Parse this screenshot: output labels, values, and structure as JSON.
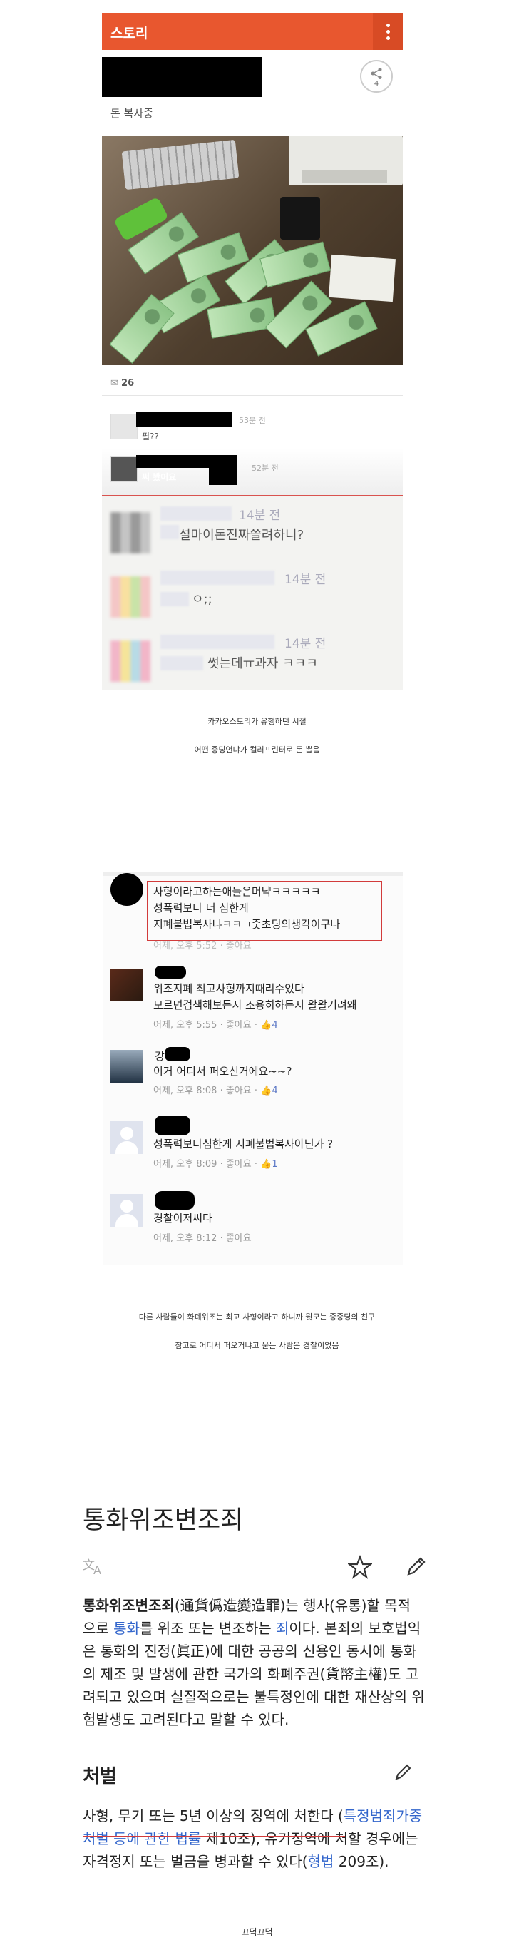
{
  "story": {
    "app_title": "스토리",
    "post_subtitle": "돈 복사중",
    "share_count": "4",
    "comment_count": "26",
    "comments": [
      {
        "time": "53분 전",
        "text": "필??"
      },
      {
        "time": "52분 전",
        "text": "써 봤어요"
      }
    ],
    "blur_comments": [
      {
        "time": "14분 전",
        "text": "설마이돈진짜쓸려하니?"
      },
      {
        "time": "14분 전",
        "text": "ㅇ;;"
      },
      {
        "time": "14분 전",
        "text": "썻는데ㅠ과자 ㅋㅋㅋ"
      }
    ]
  },
  "captions": {
    "story_1": "카카오스토리가 유행하던 시절",
    "story_2": "어떤 중딩언냐가 컬러프린터로 돈 뽑음",
    "fb_1": "다른 사람들이 화폐위조는 최고 사형이라고 하니까 뭣모는 중중딩의 친구",
    "fb_2": "참고로 어디서 퍼오거냐고 묻는 사람은 경찰이었음",
    "footer": "끄덕끄덕"
  },
  "fb": {
    "comments": [
      {
        "lines": [
          "사형이라고하는애들은머냑ㅋㅋㅋㅋㅋ",
          "성폭력보다 더 심한게",
          "지폐불법복사냐ㅋㅋㄱ줒초딩의생각이구나"
        ],
        "time": "어제, 오후 5:52",
        "like": "좋아요",
        "likes": ""
      },
      {
        "lines": [
          "위조지폐 최고사형까지때리수있다",
          "모르면검색해보든지 조용히하든지 왈왈거려왜"
        ],
        "time": "어제, 오후 5:55",
        "like": "좋아요",
        "likes": "4"
      },
      {
        "lines": [
          "이거 어디서 퍼오신거에요~~?"
        ],
        "time": "어제, 오후 8:08",
        "like": "좋아요",
        "likes": "4"
      },
      {
        "lines": [
          "성폭력보다심한게 지폐불법복사아닌가 ?"
        ],
        "time": "어제, 오후 8:09",
        "like": "좋아요",
        "likes": "1"
      },
      {
        "lines": [
          "경찰이저씨다"
        ],
        "time": "어제, 오후 8:12",
        "like": "좋아요",
        "likes": ""
      }
    ],
    "name_partial": [
      "강"
    ]
  },
  "wiki": {
    "title": "통화위조변조죄",
    "p1_lines": [
      [
        "통화위조변조죄",
        "(通貨僞造變造罪)는 행사(유통)할 목적"
      ],
      [
        "으로 ",
        "통화",
        "를 위조 또는 변조하는 ",
        "죄",
        "이다. 본죄의 보호법익"
      ],
      [
        "은 통화의 진정(眞正)에 대한 공공의 신용인 동시에 통화"
      ],
      [
        "의 제조 및 발생에 관한 국가의 화폐주권(貨幣主權)도 고"
      ],
      [
        "려되고 있으며 실질적으로는 불특정인에 대한 재산상의 위"
      ],
      [
        "험발생도 고려된다고 말할 수 있다."
      ]
    ],
    "section": "처벌",
    "p2_lines": [
      [
        "사형, 무기 또는 5년 이상의 징역에 처한다 (",
        "특정범죄가중"
      ],
      [
        "처벌 등에 관한 법률",
        " 제10조), 유기징역에 처할 경우에는"
      ],
      [
        "자격정지 또는 벌금을 병과할 수 있다(",
        "형법",
        " 209조)."
      ]
    ]
  },
  "colors": {
    "story_bar": "#e8572f",
    "link": "#3366cc",
    "highlight": "#d23b3b"
  }
}
